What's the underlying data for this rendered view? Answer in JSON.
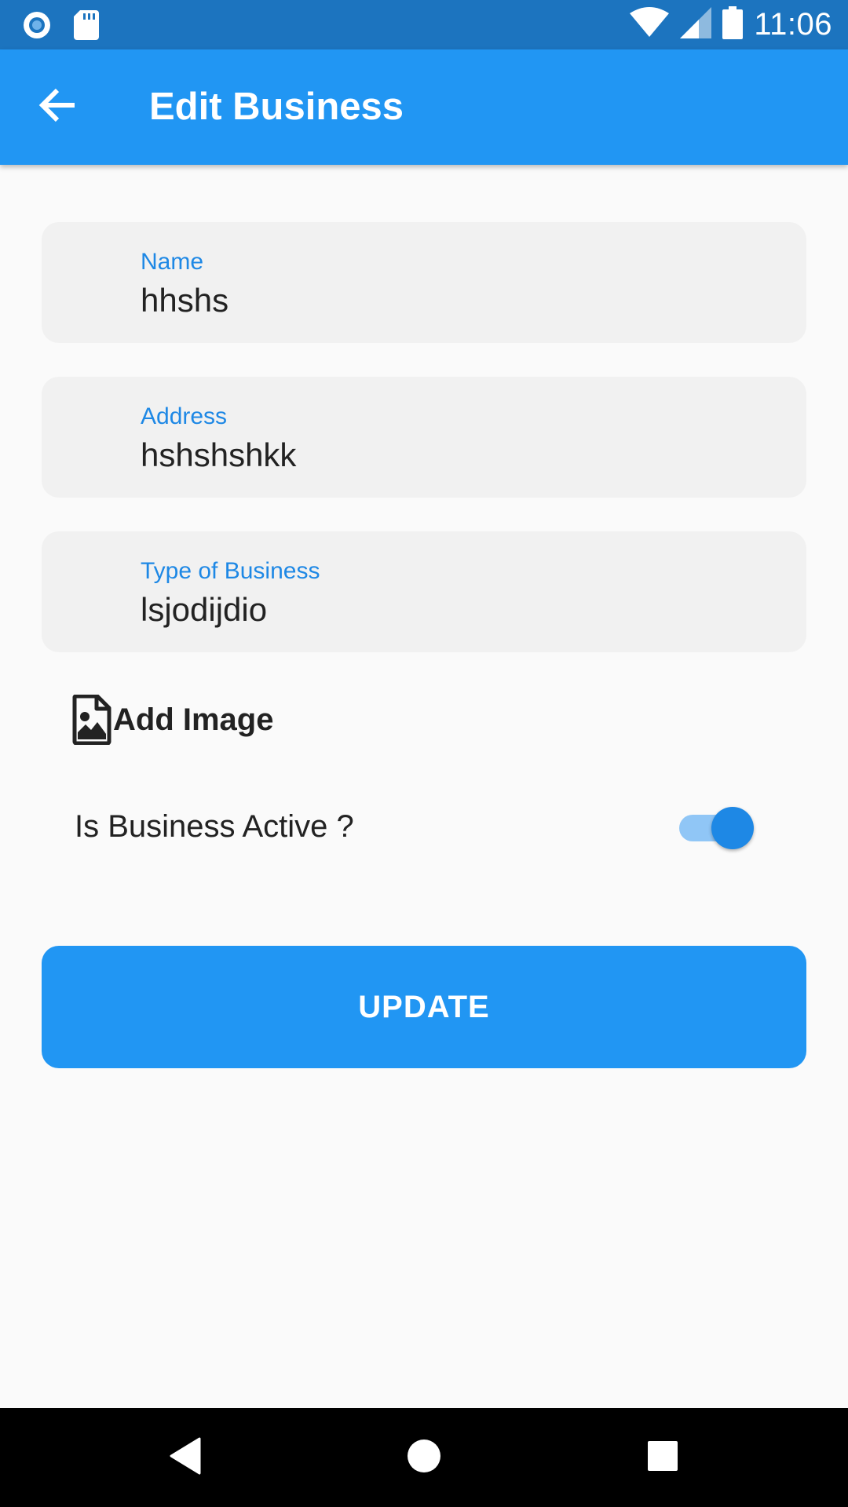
{
  "status_bar": {
    "time": "11:06",
    "left_icons": [
      "circle-notification-icon",
      "sd-card-icon"
    ],
    "right_icons": [
      "wifi-icon",
      "cell-signal-icon",
      "battery-icon"
    ],
    "color": "#1c74bf"
  },
  "app_bar": {
    "title": "Edit Business",
    "back_icon": "arrow-back-icon",
    "color": "#2196f3"
  },
  "form": {
    "name": {
      "label": "Name",
      "value": "hhshs"
    },
    "address": {
      "label": "Address",
      "value": "hshshshkk"
    },
    "type": {
      "label": "Type of Business",
      "value": "lsjodijdio"
    }
  },
  "add_image": {
    "label": "Add Image",
    "icon": "image-file-icon"
  },
  "active": {
    "label": "Is Business Active ?",
    "checked": true
  },
  "update_button": {
    "label": "UPDATE"
  },
  "nav_bar": {
    "buttons": [
      "back-triangle-icon",
      "home-circle-icon",
      "recents-square-icon"
    ]
  }
}
